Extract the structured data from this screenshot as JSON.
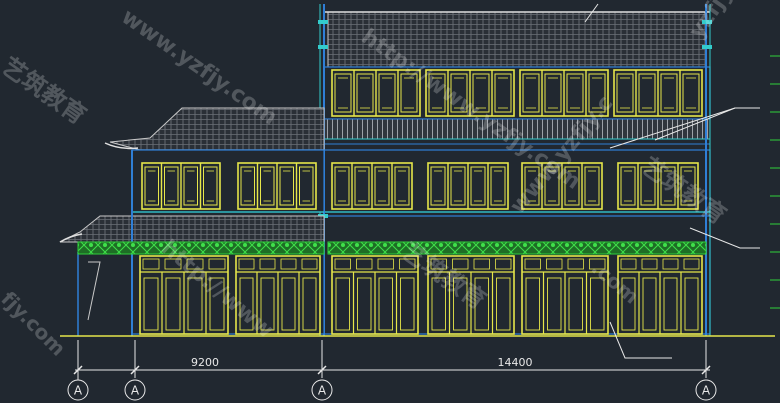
{
  "dimensions": [
    {
      "label": "9200"
    },
    {
      "label": "14400"
    }
  ],
  "axis_bubbles": [
    {
      "label": "A"
    },
    {
      "label": "A"
    },
    {
      "label": "A"
    },
    {
      "label": "A"
    }
  ],
  "watermarks": [
    "www.yzfjy.com",
    "http://www.yzfjy.com",
    "艺筑教育",
    "yzfjy",
    "fjy.com",
    "艺筑教育"
  ],
  "colors": {
    "background": "#212830",
    "structure": "#2f7fd6",
    "window_frame": "#e6e64a",
    "green_band": "#2ecf3a",
    "roof_line": "#c9c9c9",
    "cyan": "#33cccc",
    "dimension": "#e8e8e8"
  }
}
